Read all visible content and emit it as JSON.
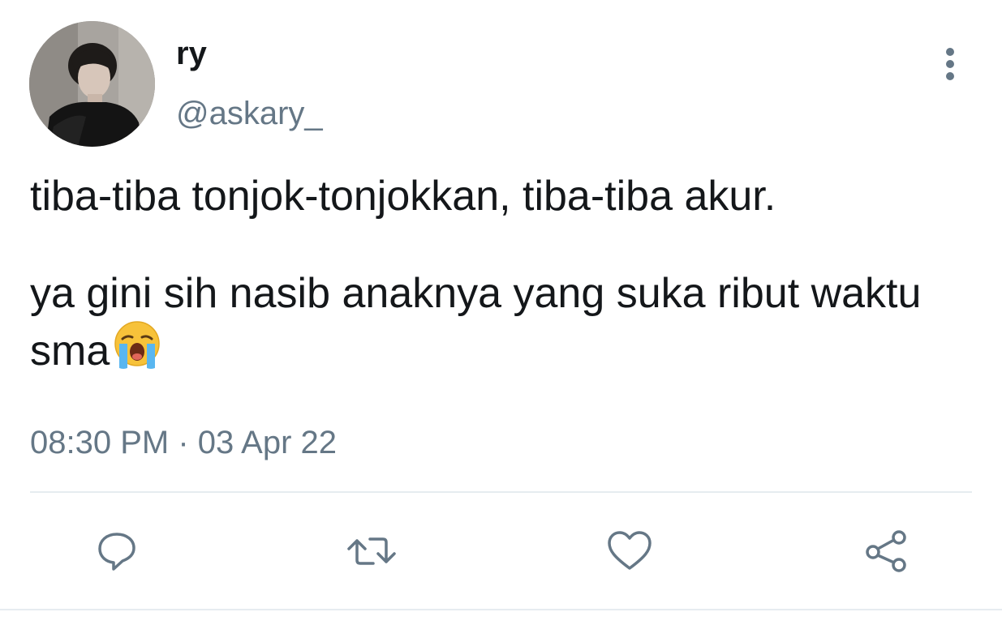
{
  "tweet": {
    "display_name": "ry",
    "handle": "@askary_",
    "text_paragraph_1": "tiba-tiba tonjok-tonjokkan, tiba-tiba akur.",
    "text_paragraph_2": "ya gini sih nasib anaknya yang suka ribut waktu sma",
    "emoji": "loudly-crying-face",
    "timestamp": "08:30 PM · 03 Apr 22"
  },
  "actions": [
    {
      "icon": "reply-icon"
    },
    {
      "icon": "retweet-icon"
    },
    {
      "icon": "like-icon"
    },
    {
      "icon": "share-icon"
    }
  ],
  "colors": {
    "text_primary": "#14171a",
    "text_secondary": "#657786",
    "divider": "#e6ecf0"
  }
}
